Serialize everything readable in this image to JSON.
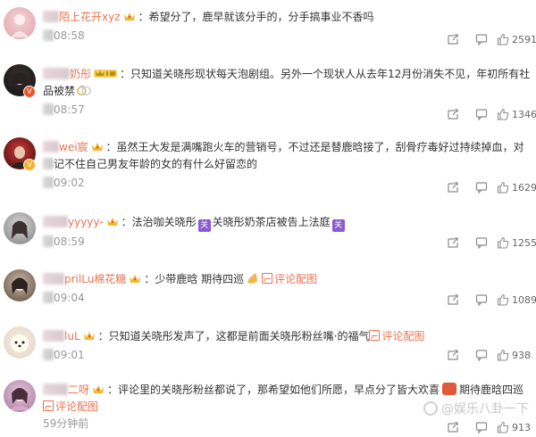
{
  "comments": [
    {
      "name": "陌上花开xyz",
      "text": "：希望分了，鹿早就该分手的，分手搞事业不香吗",
      "time": "08:58",
      "likes": "2591"
    },
    {
      "name": "奶彤",
      "text": "：只知道关晓彤现状每天泡剧组。另外一个现状人从去年12月份消失不见，年初所有社",
      "text2": "品被禁",
      "time": "08:57",
      "likes": "1346"
    },
    {
      "name": "wei宸",
      "text": "：虽然王大发是满嘴跑火车的营销号，不过还是替鹿晗接了，刮骨疗毒好过持续掉血，对",
      "text2": "记不住自己男友年龄的女的有什么好留恋的",
      "time": "09:02",
      "likes": "1629"
    },
    {
      "name": "yyyyy-",
      "text_a": "：法治咖关晓彤",
      "text_b": "关晓彤奶茶店被告上法庭",
      "time": "08:59",
      "likes": "1255"
    },
    {
      "name": "prilLu棉花糖",
      "text": "：少带鹿晗 期待四巡",
      "link": "评论配图",
      "time": "09:04",
      "likes": "1089"
    },
    {
      "name": "luL",
      "text": "：只知道关晓彤发声了，这都是前面关晓彤粉丝嘴·的福气",
      "link": "评论配图",
      "time": "09:01",
      "likes": "938"
    },
    {
      "name": "二呀",
      "text": "：评论里的关晓彤粉丝都说了，那希望如他们所愿，早点分了皆大欢喜",
      "text_b": "期待鹿晗四巡",
      "link": "评论配图",
      "time": "59分钟前",
      "likes": "913"
    }
  ],
  "tag_label": "关",
  "watermark": "@娱乐八卦一下",
  "colors": {
    "accent": "#eb7350",
    "text": "#333333",
    "time": "#999999"
  }
}
